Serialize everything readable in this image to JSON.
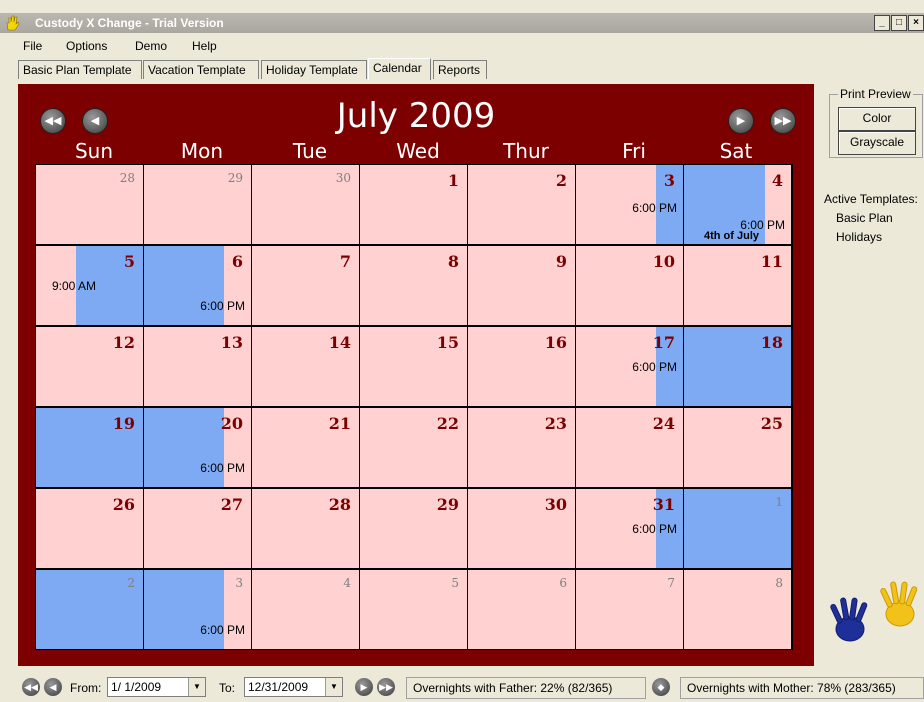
{
  "window": {
    "title": "Custody X Change - Trial Version"
  },
  "menu": {
    "file": "File",
    "options": "Options",
    "demo": "Demo",
    "help": "Help"
  },
  "tabs": [
    "Basic Plan Template",
    "Vacation Template",
    "Holiday Template",
    "Calendar",
    "Reports"
  ],
  "active_tab": "Calendar",
  "calendar": {
    "month_title": "July 2009",
    "day_names": [
      "Sun",
      "Mon",
      "Tue",
      "Wed",
      "Thur",
      "Fri",
      "Sat"
    ],
    "weeks": [
      [
        {
          "day": "28",
          "other_month": true
        },
        {
          "day": "29",
          "other_month": true
        },
        {
          "day": "30",
          "other_month": true
        },
        {
          "day": "1"
        },
        {
          "day": "2"
        },
        {
          "day": "3",
          "time": "6:00 PM"
        },
        {
          "day": "4",
          "time": "6:00 PM",
          "event": "4th of July"
        }
      ],
      [
        {
          "day": "5",
          "time": "9:00 AM"
        },
        {
          "day": "6",
          "time": "6:00 PM"
        },
        {
          "day": "7"
        },
        {
          "day": "8"
        },
        {
          "day": "9"
        },
        {
          "day": "10"
        },
        {
          "day": "11"
        }
      ],
      [
        {
          "day": "12"
        },
        {
          "day": "13"
        },
        {
          "day": "14"
        },
        {
          "day": "15"
        },
        {
          "day": "16"
        },
        {
          "day": "17",
          "time": "6:00 PM"
        },
        {
          "day": "18"
        }
      ],
      [
        {
          "day": "19"
        },
        {
          "day": "20",
          "time": "6:00 PM"
        },
        {
          "day": "21"
        },
        {
          "day": "22"
        },
        {
          "day": "23"
        },
        {
          "day": "24"
        },
        {
          "day": "25"
        }
      ],
      [
        {
          "day": "26"
        },
        {
          "day": "27"
        },
        {
          "day": "28"
        },
        {
          "day": "29"
        },
        {
          "day": "30"
        },
        {
          "day": "31",
          "time": "6:00 PM"
        },
        {
          "day": "1",
          "other_month": true
        }
      ],
      [
        {
          "day": "2",
          "other_month": true
        },
        {
          "day": "3",
          "other_month": true,
          "time": "6:00 PM"
        },
        {
          "day": "4",
          "other_month": true
        },
        {
          "day": "5",
          "other_month": true
        },
        {
          "day": "6",
          "other_month": true
        },
        {
          "day": "7",
          "other_month": true
        },
        {
          "day": "8",
          "other_month": true
        }
      ]
    ]
  },
  "print_preview": {
    "legend": "Print Preview",
    "color_button": "Color",
    "grayscale_button": "Grayscale"
  },
  "active_templates": {
    "label": "Active Templates:",
    "items": [
      "Basic Plan",
      "Holidays"
    ]
  },
  "status": {
    "from_label": "From:",
    "from_value": "1/ 1/2009",
    "to_label": "To:",
    "to_value": "12/31/2009",
    "father_overnights": "Overnights with Father: 22% (82/365)",
    "mother_overnights": "Overnights with Mother: 78% (283/365)"
  },
  "colors": {
    "frame": "#7d0000",
    "mother_day": "#ffd1d1",
    "father_day": "#7eaaf4",
    "day_number": "#7d0000"
  }
}
